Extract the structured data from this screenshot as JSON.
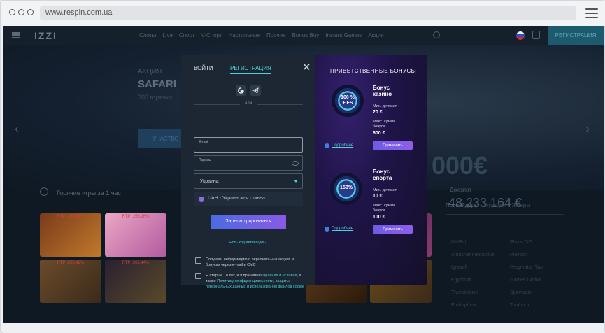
{
  "browser": {
    "url": "www.respin.com.ua",
    "menu_icon": "hamburger-icon"
  },
  "site": {
    "logo": "IZZI",
    "nav": [
      "Слоты",
      "Live",
      "Спорт",
      "V-Спорт",
      "Настольные",
      "Прочие",
      "Bonus Buy",
      "Instant Games",
      "Акции"
    ],
    "register_top": "РЕГИСТРАЦИЯ",
    "hero": {
      "label": "АКЦИЯ",
      "title": "SAFARI",
      "sub": "300 горячих",
      "cta": "УЧАСТВО"
    },
    "jackpot_label": "Джекпот",
    "jackpot_value": "48 233 164 €",
    "jackpot_big": "000€",
    "hot_games": "Горячие игры за 1 час",
    "rtp": [
      "RTP: 255.56%",
      "RTP: 255.26%",
      "RTP: 255.42%",
      "RTP: 262.44%"
    ],
    "side": {
      "tabs": [
        "Провайдеры",
        "Функции",
        "Жанры"
      ],
      "providers_left": [
        "NetEnt",
        "Amusnet Interactive",
        "Igrosoft",
        "Egyptsoft",
        "Thunderkick",
        "Endorphina"
      ],
      "providers_right": [
        "Play'n GO",
        "Playson",
        "Pragmatic Play",
        "Games Global",
        "Spinmatic",
        "Tomhorn"
      ]
    }
  },
  "modal": {
    "tab_login": "ВОЙТИ",
    "tab_register": "РЕГИСТРАЦИЯ",
    "or": "или",
    "email_label": "E-mail",
    "password_label": "Пароль",
    "country": "Украина",
    "currency": "UAH - Украинская гривна",
    "submit": "Зарегистрироваться",
    "promo_link": "Есть код активации?",
    "consent1": "Получать информацию о персональных акциях и бонусах через e-mail и СМС",
    "consent2_pre": "Я старше 18 лет, и я принимаю ",
    "consent2_link1": "Правила и условия",
    "consent2_mid": ", а также ",
    "consent2_link2": "Политику конфиденциальности, защиты персональных данных и использования файлов cookie",
    "bonuses_title": "ПРИВЕТСТВЕННЫЕ БОНУСЫ",
    "bonuses": [
      {
        "badge": "100 %\n+ FS",
        "name": "Бонус\nказино",
        "min_label": "Мин. депозит",
        "min_value": "20 €",
        "max_label": "Макс. сумма\nбонуса",
        "max_value": "600 €",
        "more": "Подробнее",
        "apply": "Применить"
      },
      {
        "badge": "150%",
        "name": "Бонус\nспорта",
        "min_label": "Мин. депозит",
        "min_value": "10 €",
        "max_label": "Макс. сумма\nбонуса",
        "max_value": "100 €",
        "more": "Подробнее",
        "apply": "Применить"
      }
    ]
  }
}
